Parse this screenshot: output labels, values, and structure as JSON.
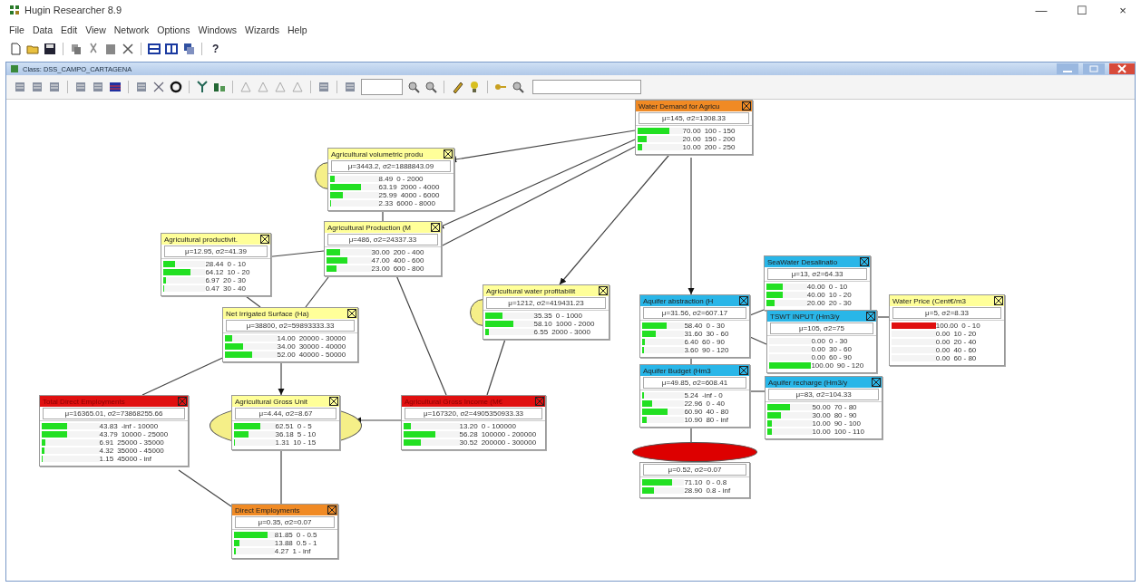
{
  "window": {
    "title": "Hugin Researcher 8.9",
    "controls": [
      "—",
      "☐",
      "×"
    ]
  },
  "menu": [
    "File",
    "Data",
    "Edit",
    "View",
    "Network",
    "Options",
    "Windows",
    "Wizards",
    "Help"
  ],
  "toolbar": {
    "help": "?"
  },
  "document": {
    "title": "Class: DSS_CAMPO_CARTAGENA"
  },
  "nodes": [
    {
      "title": "Water Demand for Agricu",
      "color": "#f08a24",
      "mean": "μ=145, σ2=1308.33",
      "evidence": false,
      "states": [
        {
          "value": "70.00",
          "range": "100 - 150",
          "level": 0.7
        },
        {
          "value": "20.00",
          "range": "150 - 200",
          "level": 0.2
        },
        {
          "value": "10.00",
          "range": "200 - 250",
          "level": 0.1
        }
      ]
    },
    {
      "title": "Agricultural volumetric produ",
      "color": "#ffff99",
      "mean": "μ=3443.2, σ2=1888843.09",
      "evidence": false,
      "ellipse": {
        "color": "#f5ef88",
        "kind": "side"
      },
      "states": [
        {
          "value": "8.49",
          "range": "0 - 2000",
          "level": 0.0849
        },
        {
          "value": "63.19",
          "range": "2000 - 4000",
          "level": 0.6319
        },
        {
          "value": "25.99",
          "range": "4000 - 6000",
          "level": 0.2599
        },
        {
          "value": "2.33",
          "range": "6000 - 8000",
          "level": 0.0233
        }
      ]
    },
    {
      "title": "Agricultural Production (M",
      "color": "#ffff99",
      "mean": "μ=486, σ2=24337.33",
      "evidence": false,
      "states": [
        {
          "value": "30.00",
          "range": "200 - 400",
          "level": 0.3
        },
        {
          "value": "47.00",
          "range": "400 - 600",
          "level": 0.47
        },
        {
          "value": "23.00",
          "range": "600 - 800",
          "level": 0.23
        }
      ]
    },
    {
      "title": "Agricultural productivit.",
      "color": "#ffff99",
      "mean": "μ=12.95, σ2=41.39",
      "evidence": false,
      "states": [
        {
          "value": "28.44",
          "range": "0 - 10",
          "level": 0.2844
        },
        {
          "value": "64.12",
          "range": "10 - 20",
          "level": 0.6412
        },
        {
          "value": "6.97",
          "range": "20 - 30",
          "level": 0.0697
        },
        {
          "value": "0.47",
          "range": "30 - 40",
          "level": 0.0047
        }
      ]
    },
    {
      "title": "Net Irrigated Surface (Ha)",
      "color": "#ffff99",
      "mean": "μ=38800, σ2=59893333.33",
      "evidence": false,
      "states": [
        {
          "value": "14.00",
          "range": "20000 - 30000",
          "level": 0.14
        },
        {
          "value": "34.00",
          "range": "30000 - 40000",
          "level": 0.34
        },
        {
          "value": "52.00",
          "range": "40000 - 50000",
          "level": 0.52
        }
      ]
    },
    {
      "title": "Agricultural water profitabilit",
      "color": "#ffff99",
      "mean": "μ=1212, σ2=419431.23",
      "evidence": false,
      "ellipse": {
        "color": "#f5ef88",
        "kind": "side"
      },
      "states": [
        {
          "value": "35.35",
          "range": "0 - 1000",
          "level": 0.3535
        },
        {
          "value": "58.10",
          "range": "1000 - 2000",
          "level": 0.581
        },
        {
          "value": "6.55",
          "range": "2000 - 3000",
          "level": 0.0655
        }
      ]
    },
    {
      "title": "Total Direct Employments",
      "color": "#e01010",
      "mean": "μ=16365.01, σ2=73868255.66",
      "evidence": false,
      "states": [
        {
          "value": "43.83",
          "range": "-inf - 10000",
          "level": 0.4383
        },
        {
          "value": "43.79",
          "range": "10000 - 25000",
          "level": 0.4379
        },
        {
          "value": "6.91",
          "range": "25000 - 35000",
          "level": 0.0691
        },
        {
          "value": "4.32",
          "range": "35000 - 45000",
          "level": 0.0432
        },
        {
          "value": "1.15",
          "range": "45000 - inf",
          "level": 0.0115
        }
      ]
    },
    {
      "title": "Agricultural Gross Unit",
      "color": "#ffff99",
      "mean": "μ=4.44, σ2=8.67",
      "evidence": false,
      "ellipse": {
        "color": "#f5ef88",
        "kind": "full"
      },
      "states": [
        {
          "value": "62.51",
          "range": "0 - 5",
          "level": 0.6251
        },
        {
          "value": "36.18",
          "range": "5 - 10",
          "level": 0.3618
        },
        {
          "value": "1.31",
          "range": "10 - 15",
          "level": 0.0131
        }
      ]
    },
    {
      "title": "Agricultural Gross Income (M€",
      "color": "#e01010",
      "mean": "μ=167320, σ2=4905350933.33",
      "evidence": false,
      "states": [
        {
          "value": "13.20",
          "range": "0 - 100000",
          "level": 0.132
        },
        {
          "value": "56.28",
          "range": "100000 - 200000",
          "level": 0.5628
        },
        {
          "value": "30.52",
          "range": "200000 - 300000",
          "level": 0.3052
        }
      ]
    },
    {
      "title": "Direct Employments",
      "color": "#f08a24",
      "mean": "μ=0.35, σ2=0.07",
      "evidence": false,
      "states": [
        {
          "value": "81.85",
          "range": "0 - 0.5",
          "level": 0.8185
        },
        {
          "value": "13.88",
          "range": "0.5 - 1",
          "level": 0.1388
        },
        {
          "value": "4.27",
          "range": "1 - inf",
          "level": 0.0427
        }
      ]
    },
    {
      "title": "Aquifer abstraction (H",
      "color": "#29b6e8",
      "mean": "μ=31.56, σ2=607.17",
      "evidence": false,
      "states": [
        {
          "value": "58.40",
          "range": "0 - 30",
          "level": 0.584
        },
        {
          "value": "31.60",
          "range": "30 - 60",
          "level": 0.316
        },
        {
          "value": "6.40",
          "range": "60 - 90",
          "level": 0.064
        },
        {
          "value": "3.60",
          "range": "90 - 120",
          "level": 0.036
        }
      ]
    },
    {
      "title": "SeaWater  Desalinatio",
      "color": "#29b6e8",
      "mean": "μ=13, σ2=64.33",
      "evidence": false,
      "states": [
        {
          "value": "40.00",
          "range": "0 - 10",
          "level": 0.4
        },
        {
          "value": "40.00",
          "range": "10 - 20",
          "level": 0.4
        },
        {
          "value": "20.00",
          "range": "20 - 30",
          "level": 0.2
        }
      ]
    },
    {
      "title": "TSWT INPUT (Hm3/y",
      "color": "#29b6e8",
      "mean": "μ=105, σ2=75",
      "evidence": false,
      "states": [
        {
          "value": "0.00",
          "range": "0 - 30",
          "level": 0
        },
        {
          "value": "0.00",
          "range": "30 - 60",
          "level": 0
        },
        {
          "value": "0.00",
          "range": "60 - 90",
          "level": 0
        },
        {
          "value": "100.00",
          "range": "90 - 120",
          "level": 1
        }
      ]
    },
    {
      "title": "Water Price (Cent€/m3",
      "color": "#ffff99",
      "mean": "μ=5, σ2=8.33",
      "evidence": true,
      "states": [
        {
          "value": "100.00",
          "range": "0 - 10",
          "level": 1
        },
        {
          "value": "0.00",
          "range": "10 - 20",
          "level": 0
        },
        {
          "value": "0.00",
          "range": "20 - 40",
          "level": 0
        },
        {
          "value": "0.00",
          "range": "40 - 60",
          "level": 0
        },
        {
          "value": "0.00",
          "range": "60 - 80",
          "level": 0
        }
      ]
    },
    {
      "title": "Aquifer Budget (Hm3",
      "color": "#29b6e8",
      "mean": "μ=49.85, σ2=608.41",
      "evidence": false,
      "states": [
        {
          "value": "5.24",
          "range": "-inf - 0",
          "level": 0.0524
        },
        {
          "value": "22.96",
          "range": "0 - 40",
          "level": 0.2296
        },
        {
          "value": "60.90",
          "range": "40 - 80",
          "level": 0.609
        },
        {
          "value": "10.90",
          "range": "80 - inf",
          "level": 0.109
        }
      ]
    },
    {
      "title": "Aquifer recharge (Hm3/y",
      "color": "#29b6e8",
      "mean": "μ=83, σ2=104.33",
      "evidence": false,
      "states": [
        {
          "value": "50.00",
          "range": "70 - 80",
          "level": 0.5
        },
        {
          "value": "30.00",
          "range": "80 - 90",
          "level": 0.3
        },
        {
          "value": "10.00",
          "range": "90 - 100",
          "level": 0.1
        },
        {
          "value": "10.00",
          "range": "100 - 110",
          "level": 0.1
        }
      ]
    },
    {
      "mean": "μ=0.52, σ2=0.07",
      "evidence": false,
      "ellipse": {
        "color": "#dd0000",
        "kind": "cover"
      },
      "states": [
        {
          "value": "71.10",
          "range": "0 - 0.8",
          "level": 0.711
        },
        {
          "value": "28.90",
          "range": "0.8 - inf",
          "level": 0.289
        }
      ]
    }
  ]
}
